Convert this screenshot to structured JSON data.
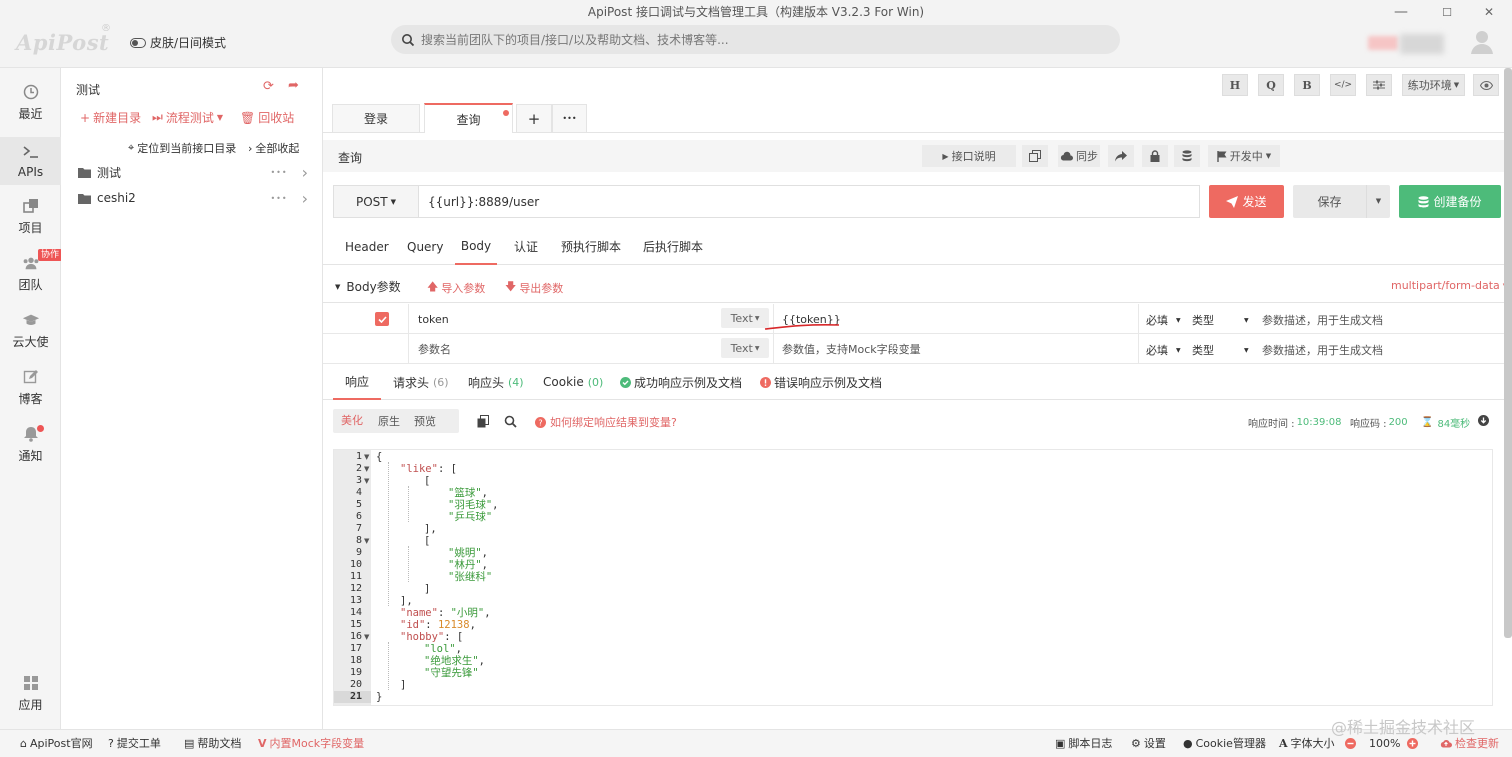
{
  "window": {
    "title": "ApiPost 接口调试与文档管理工具（构建版本 V3.2.3 For Win)",
    "min": "—",
    "max": "☐",
    "close": "✕"
  },
  "header": {
    "logo": "ApiPost",
    "logo_mark": "®",
    "skin_mode": "皮肤/日间模式",
    "search_placeholder": "搜索当前团队下的项目/接口/以及帮助文档、技术博客等..."
  },
  "rail": {
    "items": [
      {
        "label": "最近",
        "icon": "clock-icon"
      },
      {
        "label": "APIs",
        "icon": "terminal-icon"
      },
      {
        "label": "项目",
        "icon": "project-icon"
      },
      {
        "label": "团队",
        "icon": "team-icon"
      },
      {
        "label": "云大使",
        "icon": "graduation-icon"
      },
      {
        "label": "博客",
        "icon": "edit-icon"
      },
      {
        "label": "通知",
        "icon": "bell-icon"
      }
    ],
    "coop_badge": "协作",
    "apps": "应用"
  },
  "tree": {
    "title": "测试",
    "new_dir": "新建目录",
    "flow_test": "流程测试",
    "recycle": "回收站",
    "locate": "定位到当前接口目录",
    "collapse_all": "全部收起",
    "items": [
      {
        "label": "测试",
        "more": "•••",
        "arrow": "›"
      },
      {
        "label": "ceshi2",
        "more": "•••",
        "arrow": "›"
      }
    ]
  },
  "toolbar": {
    "h": "H",
    "q": "Q",
    "b": "B",
    "code": "</>",
    "env": "练功环境"
  },
  "tabs": {
    "items": [
      "登录",
      "查询"
    ],
    "add": "+",
    "more": "•••"
  },
  "request": {
    "name": "查询",
    "doc_btn": "接口说明",
    "sync_btn": "同步",
    "status_btn": "开发中",
    "method": "POST",
    "url": "{{url}}:8889/user",
    "send": "发送",
    "save": "保存",
    "backup": "创建备份"
  },
  "subtabs": [
    "Header",
    "Query",
    "Body",
    "认证",
    "预执行脚本",
    "后执行脚本"
  ],
  "body": {
    "title": "Body参数",
    "import": "导入参数",
    "export": "导出参数",
    "content_type": "multipart/form-data",
    "rows": [
      {
        "checked": true,
        "key": "token",
        "key_ph": "",
        "type": "Text",
        "value": "{{token}}",
        "value_ph": "",
        "required": "必填",
        "kind": "类型",
        "desc_ph": "参数描述，用于生成文档"
      },
      {
        "checked": false,
        "key": "",
        "key_ph": "参数名",
        "type": "Text",
        "value": "",
        "value_ph": "参数值，支持Mock字段变量",
        "required": "必填",
        "kind": "类型",
        "desc_ph": "参数描述，用于生成文档"
      }
    ]
  },
  "response": {
    "tabs": [
      {
        "label": "响应",
        "count": ""
      },
      {
        "label": "请求头",
        "count": "(6)"
      },
      {
        "label": "响应头",
        "count": "(4)"
      },
      {
        "label": "Cookie",
        "count": "(0)"
      },
      {
        "label": "成功响应示例及文档",
        "count": ""
      },
      {
        "label": "错误响应示例及文档",
        "count": ""
      }
    ],
    "views": [
      "美化",
      "原生",
      "预览"
    ],
    "bind_help": "如何绑定响应结果到变量?",
    "time_label": "响应时间 :",
    "time_value": "10:39:08",
    "code_label": "响应码 :",
    "code_value": "200",
    "duration": "84毫秒"
  },
  "code_lines": [
    {
      "n": "1",
      "fold": true,
      "indent": 0,
      "parts": [
        [
          "p",
          "{"
        ]
      ]
    },
    {
      "n": "2",
      "fold": true,
      "indent": 1,
      "parts": [
        [
          "k",
          "\"like\""
        ],
        [
          "p",
          ": ["
        ]
      ]
    },
    {
      "n": "3",
      "fold": true,
      "indent": 2,
      "parts": [
        [
          "p",
          "["
        ]
      ]
    },
    {
      "n": "4",
      "fold": false,
      "indent": 3,
      "parts": [
        [
          "s",
          "\"篮球\""
        ],
        [
          "p",
          ","
        ]
      ]
    },
    {
      "n": "5",
      "fold": false,
      "indent": 3,
      "parts": [
        [
          "s",
          "\"羽毛球\""
        ],
        [
          "p",
          ","
        ]
      ]
    },
    {
      "n": "6",
      "fold": false,
      "indent": 3,
      "parts": [
        [
          "s",
          "\"乒乓球\""
        ]
      ]
    },
    {
      "n": "7",
      "fold": false,
      "indent": 2,
      "parts": [
        [
          "p",
          "],"
        ]
      ]
    },
    {
      "n": "8",
      "fold": true,
      "indent": 2,
      "parts": [
        [
          "p",
          "["
        ]
      ]
    },
    {
      "n": "9",
      "fold": false,
      "indent": 3,
      "parts": [
        [
          "s",
          "\"姚明\""
        ],
        [
          "p",
          ","
        ]
      ]
    },
    {
      "n": "10",
      "fold": false,
      "indent": 3,
      "parts": [
        [
          "s",
          "\"林丹\""
        ],
        [
          "p",
          ","
        ]
      ]
    },
    {
      "n": "11",
      "fold": false,
      "indent": 3,
      "parts": [
        [
          "s",
          "\"张继科\""
        ]
      ]
    },
    {
      "n": "12",
      "fold": false,
      "indent": 2,
      "parts": [
        [
          "p",
          "]"
        ]
      ]
    },
    {
      "n": "13",
      "fold": false,
      "indent": 1,
      "parts": [
        [
          "p",
          "],"
        ]
      ]
    },
    {
      "n": "14",
      "fold": false,
      "indent": 1,
      "parts": [
        [
          "k",
          "\"name\""
        ],
        [
          "p",
          ": "
        ],
        [
          "s",
          "\"小明\""
        ],
        [
          "p",
          ","
        ]
      ]
    },
    {
      "n": "15",
      "fold": false,
      "indent": 1,
      "parts": [
        [
          "k",
          "\"id\""
        ],
        [
          "p",
          ": "
        ],
        [
          "n",
          "12138"
        ],
        [
          "p",
          ","
        ]
      ]
    },
    {
      "n": "16",
      "fold": true,
      "indent": 1,
      "parts": [
        [
          "k",
          "\"hobby\""
        ],
        [
          "p",
          ": ["
        ]
      ]
    },
    {
      "n": "17",
      "fold": false,
      "indent": 2,
      "parts": [
        [
          "s",
          "\"lol\""
        ],
        [
          "p",
          ","
        ]
      ]
    },
    {
      "n": "18",
      "fold": false,
      "indent": 2,
      "parts": [
        [
          "s",
          "\"绝地求生\""
        ],
        [
          "p",
          ","
        ]
      ]
    },
    {
      "n": "19",
      "fold": false,
      "indent": 2,
      "parts": [
        [
          "s",
          "\"守望先锋\""
        ]
      ]
    },
    {
      "n": "20",
      "fold": false,
      "indent": 1,
      "parts": [
        [
          "p",
          "]"
        ]
      ]
    },
    {
      "n": "21",
      "fold": false,
      "indent": 0,
      "parts": [
        [
          "p",
          "}"
        ]
      ]
    }
  ],
  "footer": {
    "left": [
      "ApiPost官网",
      "提交工单",
      "帮助文档",
      "内置Mock字段变量"
    ],
    "script_log": "脚本日志",
    "settings": "设置",
    "cookie_mgr": "Cookie管理器",
    "font_size": "字体大小",
    "zoom": "100%",
    "update": "检查更新"
  },
  "watermark": "@稀土掘金技术社区",
  "colors": {
    "accent_red": "#ee6a61",
    "success_green": "#4dbb7a",
    "link_red": "#e06666"
  }
}
